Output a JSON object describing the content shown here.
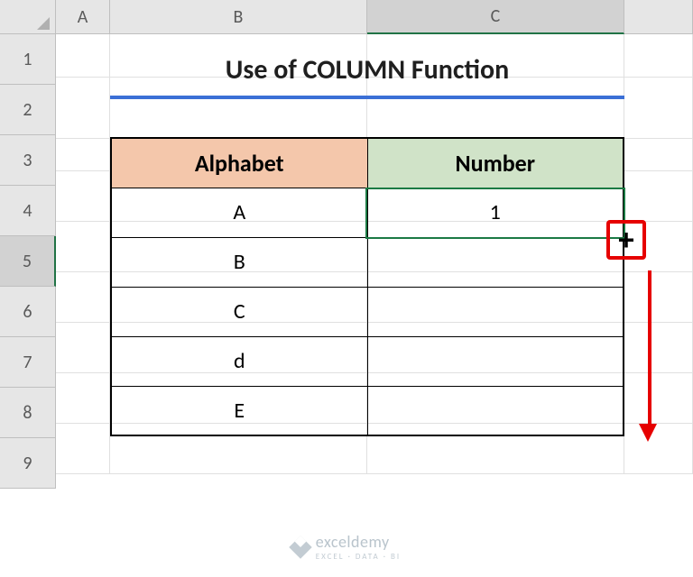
{
  "columns": {
    "a": "A",
    "b": "B",
    "c": "C"
  },
  "rows": {
    "r1": "1",
    "r2": "2",
    "r3": "3",
    "r4": "4",
    "r5": "5",
    "r6": "6",
    "r7": "7",
    "r8": "8",
    "r9": "9"
  },
  "title": "Use of COLUMN Function",
  "headers": {
    "alphabet": "Alphabet",
    "number": "Number"
  },
  "table": [
    {
      "alphabet": "A",
      "number": "1"
    },
    {
      "alphabet": "B",
      "number": ""
    },
    {
      "alphabet": "C",
      "number": ""
    },
    {
      "alphabet": "d",
      "number": ""
    },
    {
      "alphabet": "E",
      "number": ""
    }
  ],
  "fill_handle": "+",
  "watermark": {
    "brand": "exceldemy",
    "tagline": "EXCEL · DATA · BI"
  },
  "selected_cell": "C5"
}
